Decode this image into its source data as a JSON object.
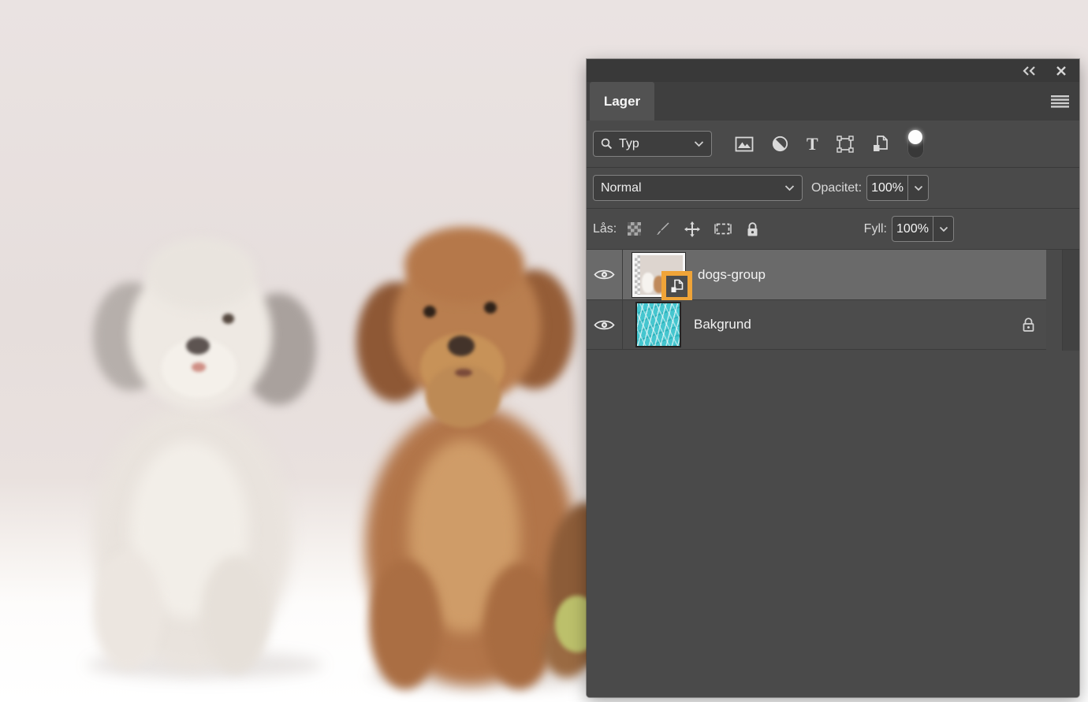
{
  "colors": {
    "highlight_orange": "#F0A438",
    "background_thumb_teal": "#45C6CF",
    "panel_background": "#4a4a4a",
    "selected_row": "#6a6a6a"
  },
  "panel": {
    "tab_label": "Lager",
    "window_controls": {
      "collapse_icon": "double-chevron-left",
      "close_icon": "close-x"
    },
    "menu_icon": "panel-menu",
    "filter_row": {
      "search_dropdown": {
        "icon": "search",
        "value": "Typ"
      },
      "filter_icons": [
        "pixel-layers-filter",
        "adjustment-layers-filter",
        "type-layers-filter",
        "shape-layers-filter",
        "smart-objects-filter"
      ],
      "toggle": "layer-filtering-toggle"
    },
    "blend_row": {
      "blend_mode": "Normal",
      "opacity_label": "Opacitet:",
      "opacity_value": "100%"
    },
    "lock_row": {
      "label": "Lås:",
      "lock_icons": [
        "lock-transparent-pixels",
        "lock-image-pixels",
        "lock-position",
        "lock-artboard-nesting",
        "lock-all"
      ],
      "fill_label": "Fyll:",
      "fill_value": "100%"
    },
    "layers": [
      {
        "name": "dogs-group",
        "selected": true,
        "visible": true,
        "type": "smart-object",
        "badge": "smart-object-badge",
        "badge_highlighted": true
      },
      {
        "name": "Bakgrund",
        "selected": false,
        "visible": true,
        "locked": true,
        "type": "background"
      }
    ]
  },
  "photo": {
    "description": "Studio photo of a white poodle and a brown poodle sitting side by side on a white surface, with a partial brown puppy and ball at right edge"
  }
}
